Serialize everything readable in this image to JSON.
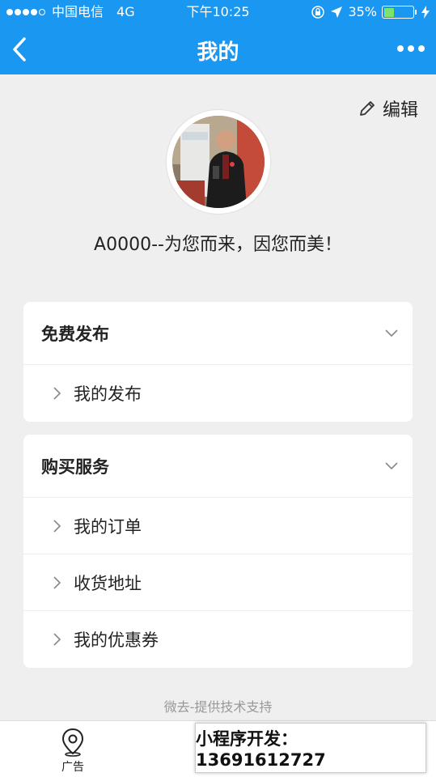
{
  "status_bar": {
    "carrier": "中国电信",
    "network": "4G",
    "time": "下午10:25",
    "battery": "35%",
    "battery_level": 0.35
  },
  "nav": {
    "title": "我的",
    "back_icon": "chevron-left-icon",
    "more_icon": "more-dots-icon"
  },
  "profile": {
    "edit_label": "编辑",
    "username": "A0000--为您而来，因您而美！"
  },
  "sections": [
    {
      "title": "免费发布",
      "items": [
        "我的发布"
      ]
    },
    {
      "title": "购买服务",
      "items": [
        "我的订单",
        "收货地址",
        "我的优惠券"
      ]
    }
  ],
  "footer": {
    "support": "微去-提供技术支持"
  },
  "tabbar": {
    "ad_label": "广告"
  },
  "promo": {
    "text": "小程序开发：13691612727"
  },
  "colors": {
    "primary": "#1a97f1",
    "background": "#efefef"
  }
}
